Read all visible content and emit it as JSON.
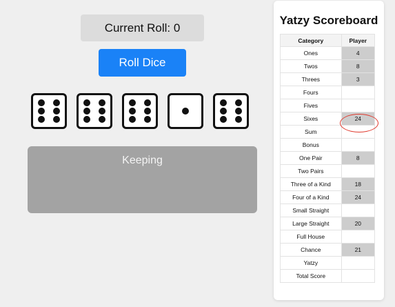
{
  "roll_display": "Current Roll: 0",
  "roll_button": "Roll Dice",
  "dice": [
    6,
    6,
    6,
    1,
    6
  ],
  "keeping_label": "Keeping",
  "scoreboard": {
    "title": "Yatzy Scoreboard",
    "headers": [
      "Category",
      "Player"
    ],
    "rows": [
      {
        "category": "Ones",
        "player": "4"
      },
      {
        "category": "Twos",
        "player": "8"
      },
      {
        "category": "Threes",
        "player": "3"
      },
      {
        "category": "Fours",
        "player": ""
      },
      {
        "category": "Fives",
        "player": ""
      },
      {
        "category": "Sixes",
        "player": "24"
      },
      {
        "category": "Sum",
        "player": ""
      },
      {
        "category": "Bonus",
        "player": ""
      },
      {
        "category": "One Pair",
        "player": "8"
      },
      {
        "category": "Two Pairs",
        "player": ""
      },
      {
        "category": "Three of a Kind",
        "player": "18"
      },
      {
        "category": "Four of a Kind",
        "player": "24"
      },
      {
        "category": "Small Straight",
        "player": ""
      },
      {
        "category": "Large Straight",
        "player": "20"
      },
      {
        "category": "Full House",
        "player": ""
      },
      {
        "category": "Chance",
        "player": "21"
      },
      {
        "category": "Yatzy",
        "player": ""
      },
      {
        "category": "Total Score",
        "player": ""
      }
    ]
  },
  "colors": {
    "roll_button": "#1a82f7",
    "keeping_area": "#a3a3a3",
    "highlight_ring": "#e03a2e"
  }
}
